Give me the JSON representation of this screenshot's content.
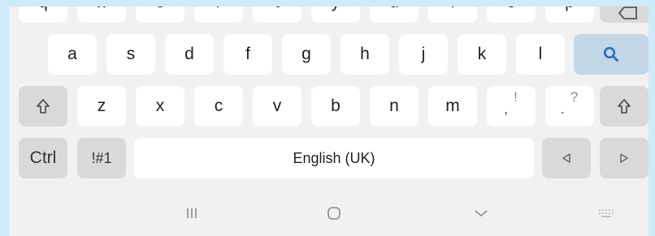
{
  "keyboard": {
    "row1": [
      "q",
      "w",
      "e",
      "r",
      "t",
      "y",
      "u",
      "i",
      "o",
      "p"
    ],
    "row2": [
      "a",
      "s",
      "d",
      "f",
      "g",
      "h",
      "j",
      "k",
      "l"
    ],
    "row3": [
      "z",
      "x",
      "c",
      "v",
      "b",
      "n",
      "m"
    ],
    "punct_comma": {
      "main": ",",
      "alt": "!"
    },
    "punct_period": {
      "main": ".",
      "alt": "?"
    },
    "ctrl_label": "Ctrl",
    "symbols_label": "!#1",
    "space_label": "English (UK)",
    "icons": {
      "search": "search-icon",
      "shift": "shift-icon",
      "backspace": "backspace-icon",
      "left": "arrow-left-icon",
      "right": "arrow-right-icon"
    },
    "colors": {
      "accent": "#2a6fb5",
      "key_bg": "#ffffff",
      "func_key_bg": "#d9d9d9",
      "search_key_bg": "#c3d7e7"
    }
  },
  "nav_bar": {
    "icons": [
      "recent-apps-icon",
      "home-icon",
      "back-icon",
      "keyboard-hide-icon"
    ]
  }
}
